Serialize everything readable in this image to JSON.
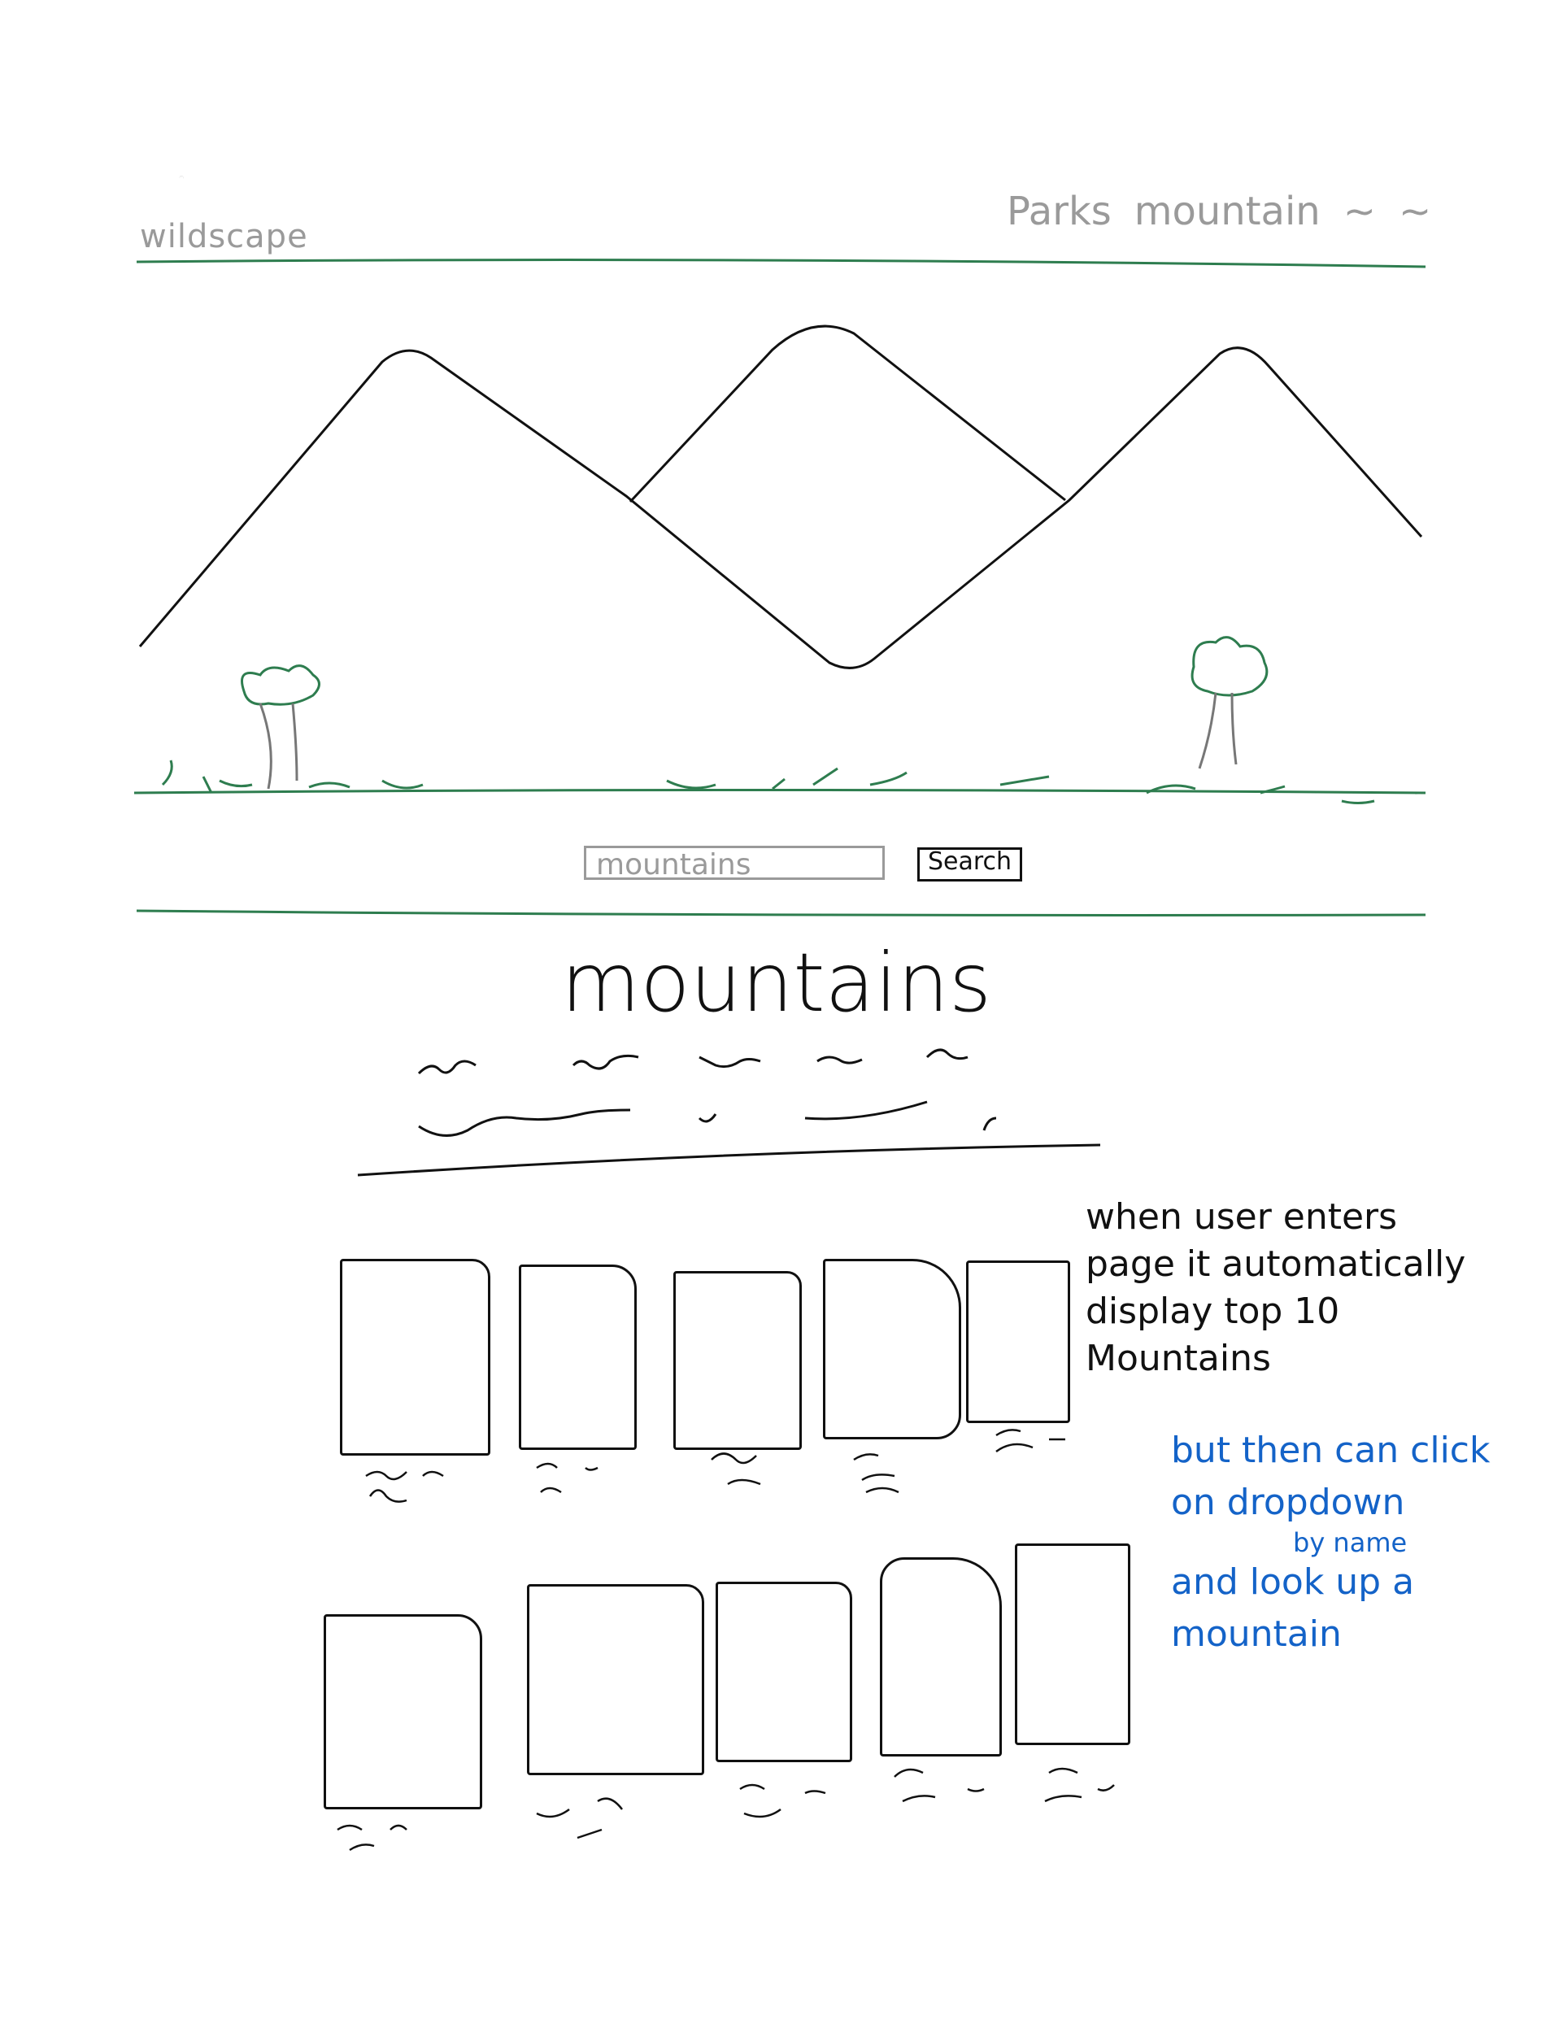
{
  "header": {
    "logo_text": "wildscape",
    "nav": [
      "Parks",
      "mountain"
    ]
  },
  "search": {
    "value": "mountains",
    "button_label": "Search"
  },
  "main": {
    "title": "mountains",
    "cards_row_1": 5,
    "cards_row_2": 5
  },
  "annotations": {
    "note_black": "when user enters page it automatically display top 10 Mountains",
    "note_blue": "but then can click on dropdown",
    "note_blue_small": "by name",
    "note_blue_end": "and look up a mountain"
  },
  "colors": {
    "green": "#2e7d4f",
    "blue_note": "#1463c8",
    "gray": "#9a9a9a"
  }
}
